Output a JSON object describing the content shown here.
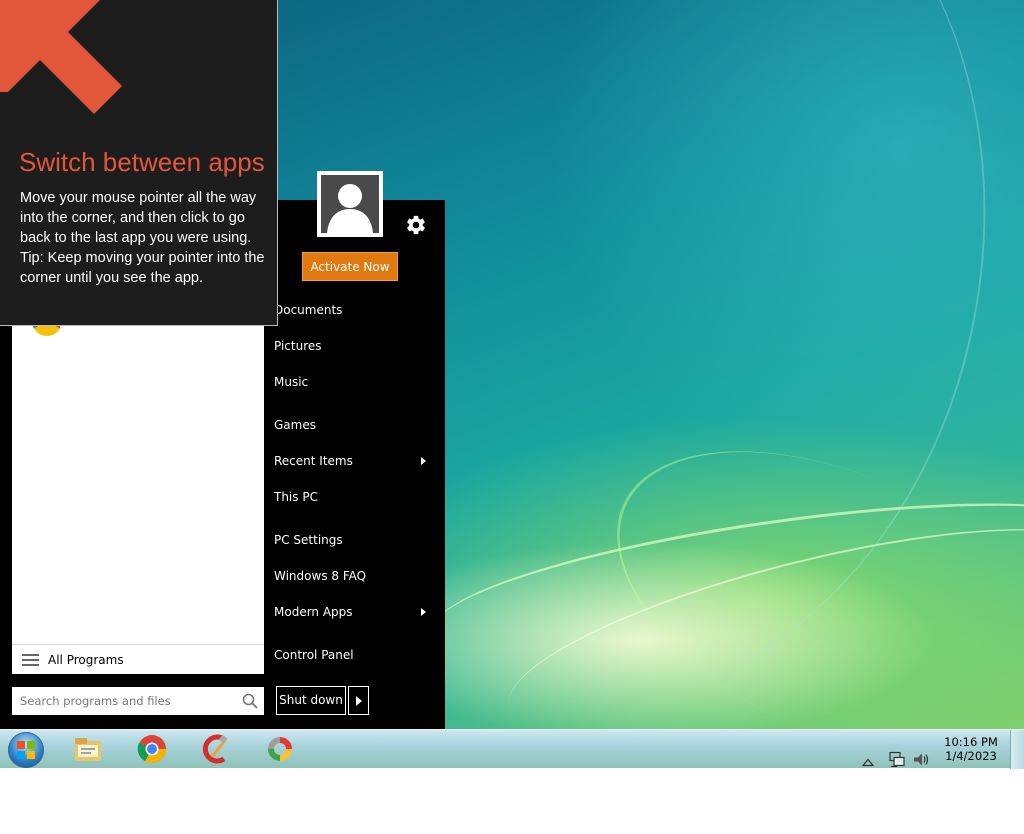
{
  "tip": {
    "title": "Switch between apps",
    "line1": "Move your mouse pointer all the way into the corner, and then click to go back to the last app you were using.",
    "line2": "Tip: Keep moving your pointer into the corner until you see the app."
  },
  "start_menu": {
    "activate_label": "Activate Now",
    "all_programs_label": "All Programs",
    "search_placeholder": "Search programs and files",
    "items": [
      {
        "label": "Documents",
        "submenu": false
      },
      {
        "label": "Pictures",
        "submenu": false
      },
      {
        "label": "Music",
        "submenu": false
      },
      {
        "label": "Games",
        "submenu": false
      },
      {
        "label": "Recent Items",
        "submenu": true
      },
      {
        "label": "This PC",
        "submenu": false
      },
      {
        "label": "PC Settings",
        "submenu": false
      },
      {
        "label": "Windows 8 FAQ",
        "submenu": false
      },
      {
        "label": "Modern Apps",
        "submenu": true
      },
      {
        "label": "Control Panel",
        "submenu": false
      }
    ],
    "shutdown_label": "Shut down"
  },
  "taskbar": {
    "pinned": [
      {
        "icon": "file-explorer-icon"
      },
      {
        "icon": "chrome-icon"
      },
      {
        "icon": "ccleaner-icon"
      },
      {
        "icon": "app-icon"
      }
    ],
    "tray_icons": [
      "show-hidden-icons-icon",
      "network-icon",
      "volume-icon"
    ],
    "time": "10:16 PM",
    "date": "1/4/2023"
  },
  "colors": {
    "accent_orange": "#e07a10",
    "tip_title": "#e2573a"
  }
}
